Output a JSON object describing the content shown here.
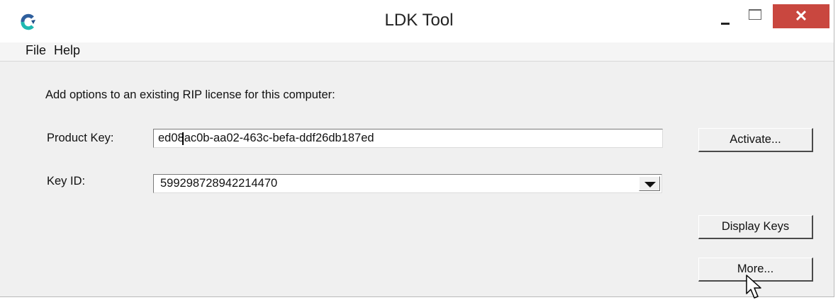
{
  "window": {
    "title": "LDK Tool"
  },
  "titlebar": {
    "close_glyph": "✕"
  },
  "menu": {
    "items": [
      "File",
      "Help"
    ]
  },
  "form": {
    "intro": "Add options to an existing RIP license for this computer:",
    "product_key_label": "Product Key:",
    "product_key_value": "ed08ac0b-aa02-463c-befa-ddf26db187ed",
    "key_id_label": "Key ID:",
    "key_id_value": "599298728942214470"
  },
  "buttons": {
    "activate": "Activate...",
    "display_keys": "Display Keys",
    "more": "More..."
  },
  "icons": {
    "app": "ldk-app-icon",
    "minimize": "minimize-icon",
    "maximize": "maximize-icon",
    "close": "close-icon",
    "dropdown": "chevron-down-icon",
    "cursor": "mouse-pointer-icon"
  },
  "colors": {
    "close_button": "#c9473f",
    "window_bg": "#f0f0f0",
    "app_icon_blue": "#2f5f9d",
    "app_icon_teal": "#1fb9b1"
  }
}
